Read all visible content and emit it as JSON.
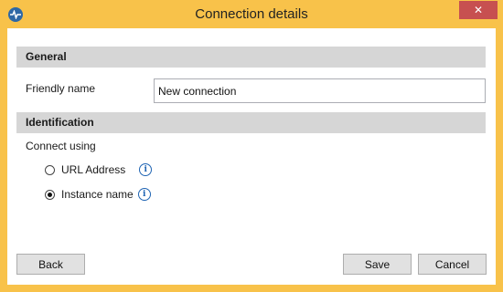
{
  "window": {
    "title": "Connection details",
    "close_glyph": "✕",
    "app_icon": "pulse-logo-icon"
  },
  "sections": {
    "general": {
      "header": "General",
      "friendly_name_label": "Friendly name",
      "friendly_name_value": "New connection"
    },
    "identification": {
      "header": "Identification",
      "connect_using_label": "Connect using",
      "options": [
        {
          "label": "URL Address",
          "selected": false,
          "info_icon": "info-icon"
        },
        {
          "label": "Instance name",
          "selected": true,
          "info_icon": "info-icon"
        }
      ]
    }
  },
  "buttons": {
    "back": "Back",
    "save": "Save",
    "cancel": "Cancel"
  },
  "colors": {
    "titlebar": "#f8c24a",
    "close": "#c75050",
    "section_header": "#d6d6d6",
    "info": "#1f64b3"
  }
}
